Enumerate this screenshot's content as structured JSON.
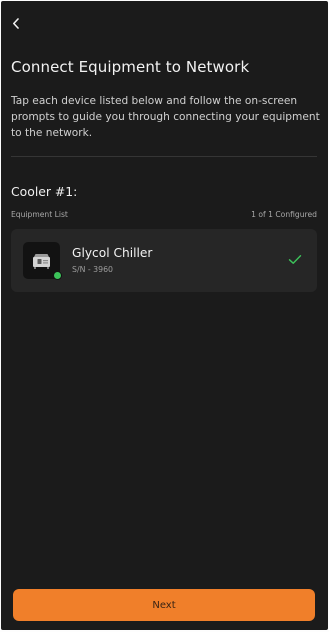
{
  "header": {
    "back_icon": "chevron-left-icon",
    "title": "Connect Equipment to Network"
  },
  "intro": {
    "description": "Tap each device listed below and follow the on-screen prompts to guide you through connecting your equipment to the network."
  },
  "section": {
    "title": "Cooler #1:",
    "list_label": "Equipment List",
    "configured_count": "1 of 1 Configured"
  },
  "devices": [
    {
      "name": "Glycol Chiller",
      "serial": "S/N - 3960",
      "icon": "chiller-unit-icon",
      "status": "online",
      "status_color": "#3cc35a",
      "configured": true,
      "check_color": "#3cc35a"
    }
  ],
  "footer": {
    "next_label": "Next"
  },
  "colors": {
    "background": "#1b1b1b",
    "card": "#262626",
    "accent": "#f07f2a"
  }
}
